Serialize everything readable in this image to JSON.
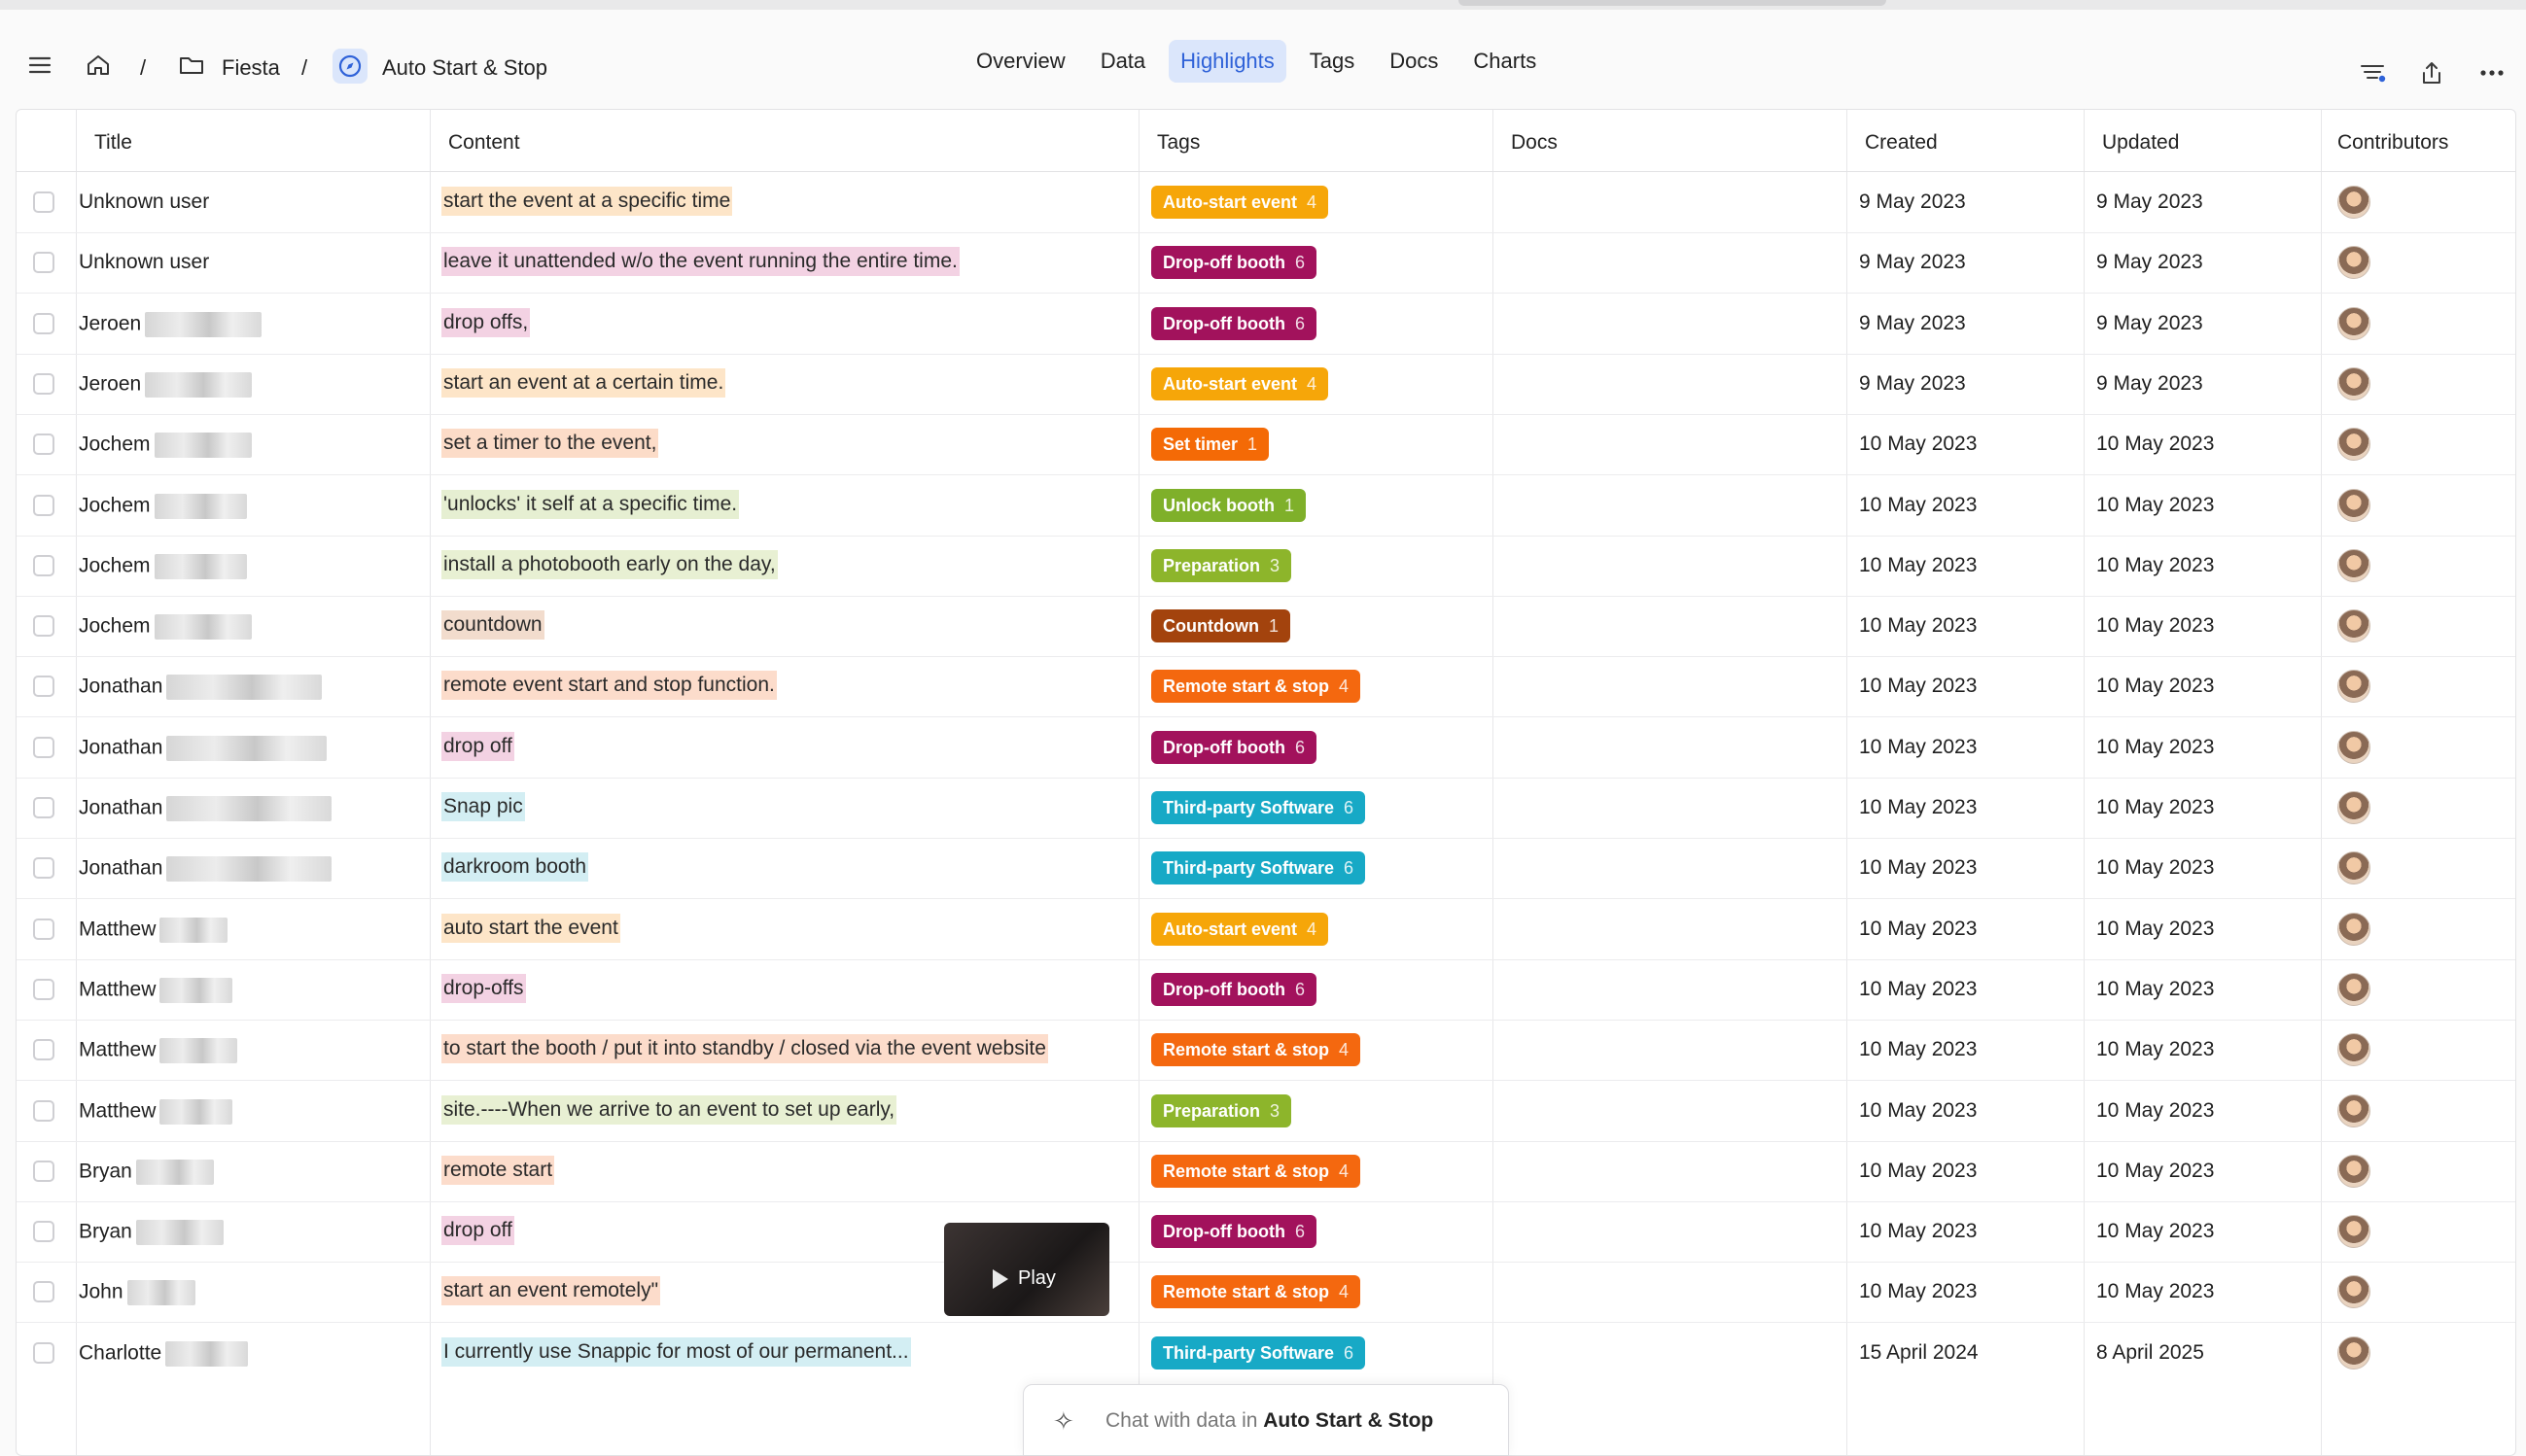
{
  "breadcrumb": {
    "workspace": "Fiesta",
    "separator": "/",
    "project": "Auto Start & Stop"
  },
  "nav": {
    "tabs": [
      {
        "label": "Overview",
        "active": false
      },
      {
        "label": "Data",
        "active": false
      },
      {
        "label": "Highlights",
        "active": true
      },
      {
        "label": "Tags",
        "active": false
      },
      {
        "label": "Docs",
        "active": false
      },
      {
        "label": "Charts",
        "active": false
      }
    ]
  },
  "header_icons": [
    "menu-icon",
    "home-icon",
    "folder-icon",
    "compass-icon",
    "filter-icon",
    "share-icon",
    "more-icon"
  ],
  "columns": [
    "Title",
    "Content",
    "Tags",
    "Docs",
    "Created",
    "Updated",
    "Contributors"
  ],
  "colors": {
    "accent": "#2f62d8",
    "tag_auto_start": "#f6a609",
    "tag_dropoff": "#a2125c",
    "tag_set_timer": "#f46a06",
    "tag_unlock": "#7fb02a",
    "tag_preparation": "#8db52b",
    "tag_countdown": "#a3430d",
    "tag_remote": "#f4680f",
    "tag_third_party": "#17a9c6"
  },
  "rows": [
    {
      "title": "Unknown user",
      "content": "start the event at a specific time",
      "tag": "Auto-start event",
      "count": "4",
      "kind": "auto",
      "created": "9 May 2023",
      "updated": "9 May 2023",
      "blur": 0
    },
    {
      "title": "Unknown user",
      "content": "leave it unattended w/o the event running the entire time.",
      "tag": "Drop-off booth",
      "count": "6",
      "kind": "drop",
      "created": "9 May 2023",
      "updated": "9 May 2023",
      "blur": 0
    },
    {
      "title": "Jeroen",
      "content": "drop offs,",
      "tag": "Drop-off booth",
      "count": "6",
      "kind": "drop",
      "created": "9 May 2023",
      "updated": "9 May 2023",
      "blur": 120
    },
    {
      "title": "Jeroen",
      "content": "start an event at a certain time.",
      "tag": "Auto-start event",
      "count": "4",
      "kind": "auto",
      "created": "9 May 2023",
      "updated": "9 May 2023",
      "blur": 110
    },
    {
      "title": "Jochem",
      "content": "set a timer to the event,",
      "tag": "Set timer",
      "count": "1",
      "kind": "timer",
      "created": "10 May 2023",
      "updated": "10 May 2023",
      "blur": 100
    },
    {
      "title": "Jochem",
      "content": "'unlocks' it self at a specific time.",
      "tag": "Unlock booth",
      "count": "1",
      "kind": "unlock",
      "created": "10 May 2023",
      "updated": "10 May 2023",
      "blur": 95
    },
    {
      "title": "Jochem",
      "content": "install a photobooth early on the day,",
      "tag": "Preparation",
      "count": "3",
      "kind": "prep",
      "created": "10 May 2023",
      "updated": "10 May 2023",
      "blur": 95
    },
    {
      "title": "Jochem",
      "content": "countdown",
      "tag": "Countdown",
      "count": "1",
      "kind": "count",
      "created": "10 May 2023",
      "updated": "10 May 2023",
      "blur": 100
    },
    {
      "title": "Jonathan",
      "content": "remote event start and stop function.",
      "tag": "Remote start & stop",
      "count": "4",
      "kind": "remote",
      "created": "10 May 2023",
      "updated": "10 May 2023",
      "blur": 160
    },
    {
      "title": "Jonathan",
      "content": "drop off",
      "tag": "Drop-off booth",
      "count": "6",
      "kind": "drop",
      "created": "10 May 2023",
      "updated": "10 May 2023",
      "blur": 165
    },
    {
      "title": "Jonathan",
      "content": "Snap pic",
      "tag": "Third-party Software",
      "count": "6",
      "kind": "third",
      "created": "10 May 2023",
      "updated": "10 May 2023",
      "blur": 170
    },
    {
      "title": "Jonathan",
      "content": "darkroom booth",
      "tag": "Third-party Software",
      "count": "6",
      "kind": "third",
      "created": "10 May 2023",
      "updated": "10 May 2023",
      "blur": 170
    },
    {
      "title": "Matthew",
      "content": "auto start the event",
      "tag": "Auto-start event",
      "count": "4",
      "kind": "auto",
      "created": "10 May 2023",
      "updated": "10 May 2023",
      "blur": 70
    },
    {
      "title": "Matthew",
      "content": "drop-offs",
      "tag": "Drop-off booth",
      "count": "6",
      "kind": "drop",
      "created": "10 May 2023",
      "updated": "10 May 2023",
      "blur": 75
    },
    {
      "title": "Matthew",
      "content": "to start the booth / put it into standby / closed via the event website",
      "tag": "Remote start & stop",
      "count": "4",
      "kind": "remote",
      "created": "10 May 2023",
      "updated": "10 May 2023",
      "blur": 80
    },
    {
      "title": "Matthew",
      "content": "site.----When we arrive to an event to set up early,",
      "tag": "Preparation",
      "count": "3",
      "kind": "prep",
      "created": "10 May 2023",
      "updated": "10 May 2023",
      "blur": 75
    },
    {
      "title": "Bryan",
      "content": "remote start",
      "tag": "Remote start & stop",
      "count": "4",
      "kind": "remote",
      "created": "10 May 2023",
      "updated": "10 May 2023",
      "blur": 80
    },
    {
      "title": "Bryan",
      "content": "drop off",
      "tag": "Drop-off booth",
      "count": "6",
      "kind": "drop",
      "created": "10 May 2023",
      "updated": "10 May 2023",
      "blur": 90
    },
    {
      "title": "John",
      "content": "start an event remotely\"",
      "tag": "Remote start & stop",
      "count": "4",
      "kind": "remote",
      "created": "10 May 2023",
      "updated": "10 May 2023",
      "blur": 70
    },
    {
      "title": "Charlotte",
      "content": "I currently use Snappic for most of our permanent...",
      "tag": "Third-party Software",
      "count": "6",
      "kind": "third",
      "created": "15 April 2024",
      "updated": "8 April 2025",
      "blur": 85
    }
  ],
  "video": {
    "label": "Play"
  },
  "chat": {
    "prefix": "Chat with data in ",
    "target": "Auto Start & Stop"
  }
}
